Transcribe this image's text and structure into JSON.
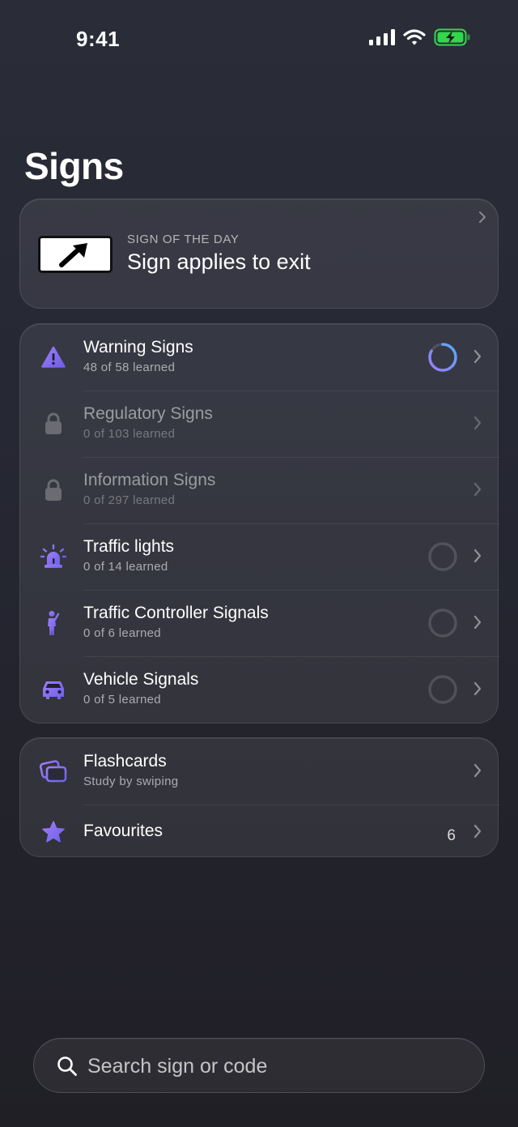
{
  "status_bar": {
    "time": "9:41"
  },
  "page": {
    "title": "Signs"
  },
  "sign_of_the_day": {
    "kicker": "SIGN OF THE DAY",
    "title": "Sign applies to exit"
  },
  "categories": [
    {
      "title": "Warning Signs",
      "subtitle": "48 of 58 learned",
      "icon": "warning-triangle-icon",
      "locked": false,
      "progress": 0.83
    },
    {
      "title": "Regulatory Signs",
      "subtitle": "0 of 103 learned",
      "icon": "lock-icon",
      "locked": true
    },
    {
      "title": "Information Signs",
      "subtitle": "0 of 297 learned",
      "icon": "lock-icon",
      "locked": true
    },
    {
      "title": "Traffic lights",
      "subtitle": "0 of 14 learned",
      "icon": "siren-light-icon",
      "locked": false,
      "progress": 0
    },
    {
      "title": "Traffic Controller Signals",
      "subtitle": "0 of 6 learned",
      "icon": "person-standing-icon",
      "locked": false,
      "progress": 0
    },
    {
      "title": "Vehicle Signals",
      "subtitle": "0 of 5 learned",
      "icon": "car-icon",
      "locked": false,
      "progress": 0
    }
  ],
  "tools": {
    "flashcards": {
      "title": "Flashcards",
      "subtitle": "Study by swiping",
      "icon": "cards-stack-icon"
    },
    "favourites": {
      "title": "Favourites",
      "count": "6",
      "icon": "star-icon"
    }
  },
  "search": {
    "placeholder": "Search sign or code"
  },
  "colors": {
    "accent": "#8b7cf6",
    "accent_blue": "#6aa5ff",
    "battery": "#32d74b"
  }
}
